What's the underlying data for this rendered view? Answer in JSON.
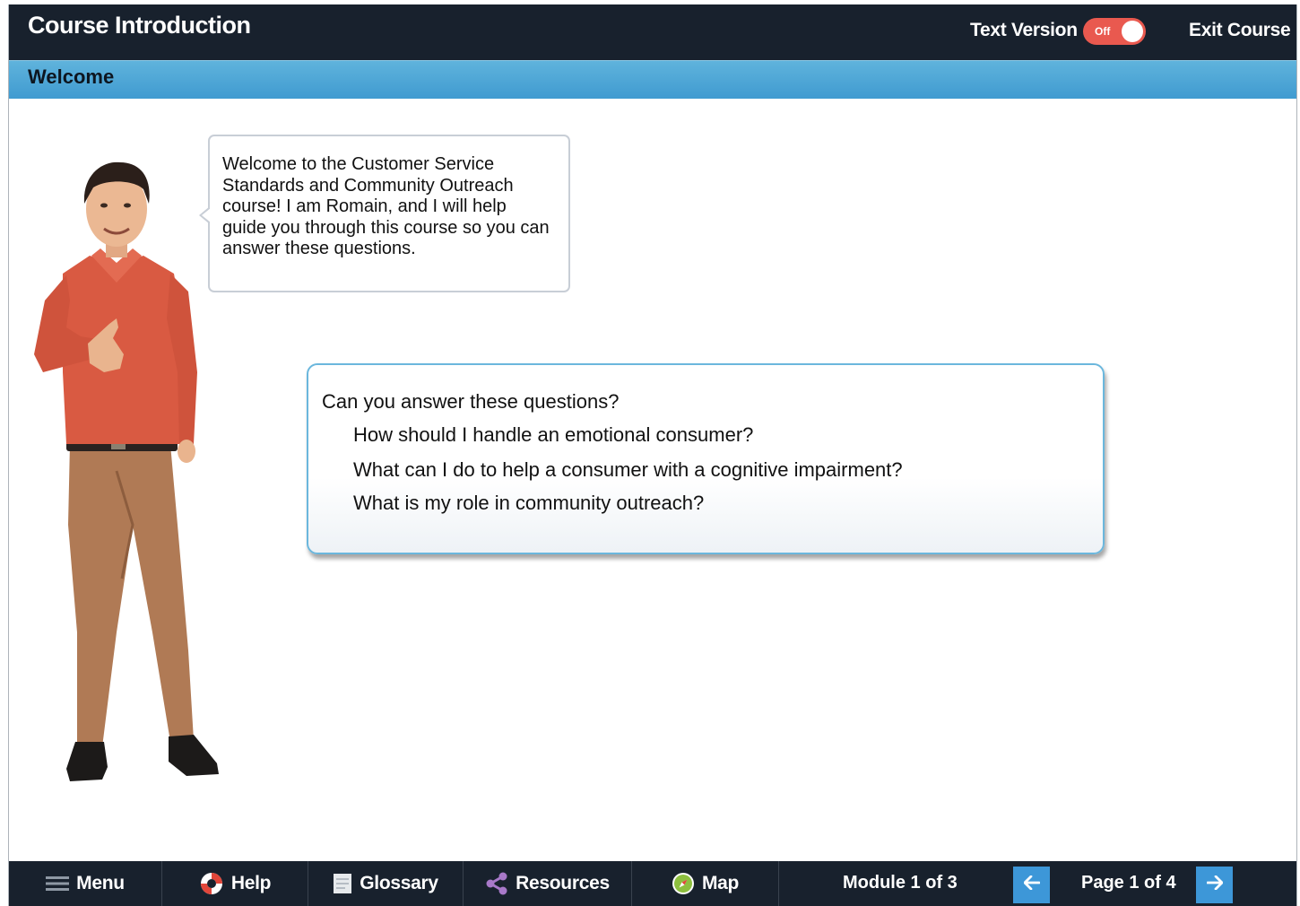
{
  "header": {
    "title": "Course Introduction",
    "text_version_label": "Text Version",
    "toggle_state": "Off",
    "exit_label": "Exit Course",
    "toggle_color": "#e9594f"
  },
  "section": {
    "title": "Welcome"
  },
  "speech_bubble": {
    "text": "Welcome to the Customer Service Standards and Community Outreach course! I am Romain, and I will help guide you through this course so you can answer these questions."
  },
  "questions": {
    "heading": "Can you answer these questions?",
    "items": [
      "How should I handle an emotional consumer?",
      "What can I do to help a consumer with a cognitive impairment?",
      "What is my role in community outreach?"
    ]
  },
  "footer": {
    "menu_label": "Menu",
    "help_label": "Help",
    "glossary_label": "Glossary",
    "resources_label": "Resources",
    "map_label": "Map",
    "module_label": "Module 1 of 3",
    "page_label": "Page 1 of 4",
    "accent_color": "#3d97d8"
  },
  "icons": {
    "menu": "hamburger-icon",
    "help": "lifebuoy-icon",
    "glossary": "book-icon",
    "resources": "share-icon",
    "map": "compass-icon",
    "prev": "arrow-left-icon",
    "next": "arrow-right-icon"
  }
}
